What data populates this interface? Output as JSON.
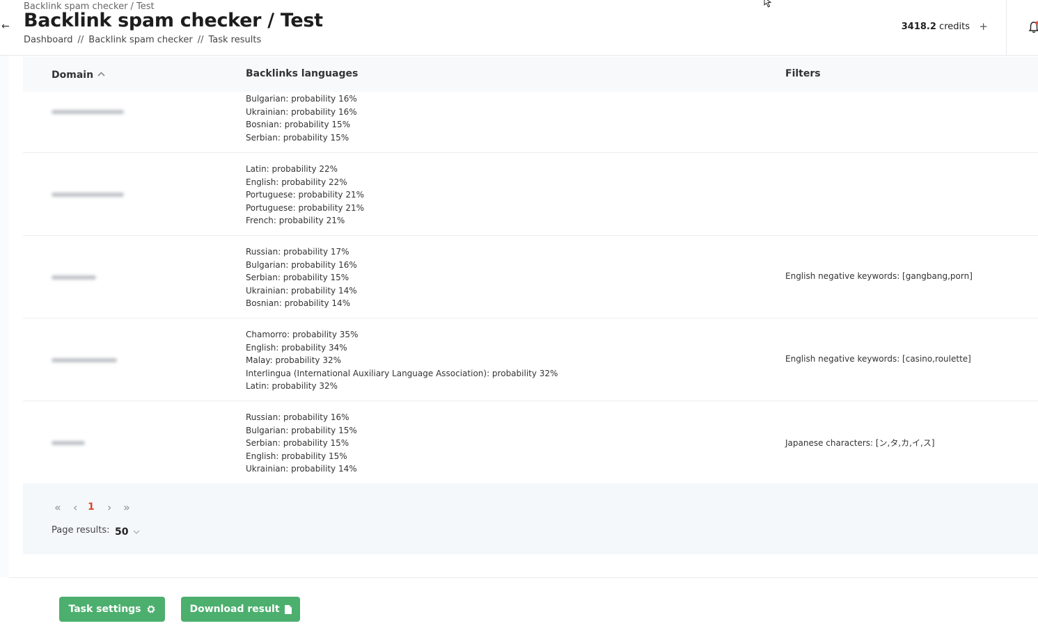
{
  "header": {
    "window_title": "Backlink spam checker / Test",
    "page_title": "Backlink spam checker / Test",
    "breadcrumb": [
      "Dashboard",
      "Backlink spam checker",
      "Task results"
    ],
    "breadcrumb_separator": "//",
    "credits_value": "3418.2",
    "credits_unit": "credits",
    "credits_add": "+",
    "back_icon": "arrow-left-icon",
    "bell_icon": "bell-icon"
  },
  "table": {
    "columns": [
      "Domain",
      "Backlinks languages",
      "Filters"
    ],
    "sort_icon": "chevron-up-icon",
    "rows": [
      {
        "languages": [
          "Bulgarian: probability 16%",
          "Ukrainian: probability 16%",
          "Bosnian: probability 15%",
          "Serbian: probability 15%"
        ],
        "filter": ""
      },
      {
        "languages": [
          "Latin: probability 22%",
          "English: probability 22%",
          "Portuguese: probability 21%",
          "Portuguese: probability 21%",
          "French: probability 21%"
        ],
        "filter": ""
      },
      {
        "languages": [
          "Russian: probability 17%",
          "Bulgarian: probability 16%",
          "Serbian: probability 15%",
          "Ukrainian: probability 14%",
          "Bosnian: probability 14%"
        ],
        "filter": "English negative keywords: [gangbang,porn]"
      },
      {
        "languages": [
          "Chamorro: probability 35%",
          "English: probability 34%",
          "Malay: probability 32%",
          "Interlingua (International Auxiliary Language Association): probability 32%",
          "Latin: probability 32%"
        ],
        "filter": "English negative keywords: [casino,roulette]"
      },
      {
        "languages": [
          "Russian: probability 16%",
          "Bulgarian: probability 15%",
          "Serbian: probability 15%",
          "English: probability 15%",
          "Ukrainian: probability 14%"
        ],
        "filter": "Japanese characters: [ン,タ,カ,イ,ス]"
      }
    ]
  },
  "pagination": {
    "first": "«",
    "prev": "‹",
    "current_page": "1",
    "next": "›",
    "last": "»",
    "page_results_label": "Page results:",
    "page_results_value": "50"
  },
  "footer": {
    "task_settings_label": "Task settings",
    "task_settings_icon": "gear-icon",
    "download_label": "Download result",
    "download_icon": "file-icon"
  },
  "colors": {
    "accent_green": "#4caf6e",
    "current_page": "#d9472b",
    "table_header_bg": "#f7f9fb"
  }
}
